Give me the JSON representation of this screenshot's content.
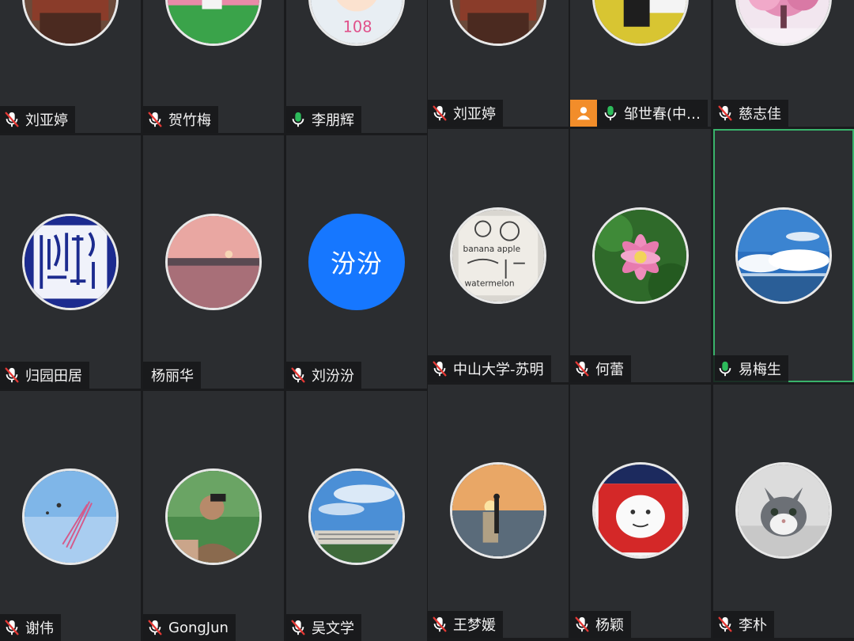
{
  "colors": {
    "tile_bg": "#2b2d30",
    "active_border": "#39b36b",
    "mic_on": "#2dbb5b",
    "mic_muted": "#e53935",
    "host_badge": "#f28d2a",
    "text_avatar": "#1677ff"
  },
  "participants": [
    {
      "name": "刘亚婷",
      "mic": "muted",
      "avatar": "photo-room"
    },
    {
      "name": "贺竹梅",
      "mic": "muted",
      "avatar": "photo-flowers"
    },
    {
      "name": "李朋辉",
      "mic": "on",
      "avatar": "cartoon-108"
    },
    {
      "name": "刘亚婷",
      "mic": "muted",
      "avatar": "photo-room"
    },
    {
      "name": "邹世春(中…",
      "mic": "on",
      "avatar": "photo-man-car",
      "host": true
    },
    {
      "name": "慈志佳",
      "mic": "muted",
      "avatar": "photo-pink-tree"
    },
    {
      "name": "归园田居",
      "mic": "muted",
      "avatar": "seal-stamp"
    },
    {
      "name": "杨丽华",
      "mic": "none",
      "avatar": "photo-sunset-river"
    },
    {
      "name": "刘汾汾",
      "mic": "muted",
      "avatar": "text",
      "avatar_text": "汾汾"
    },
    {
      "name": "中山大学-苏明",
      "mic": "muted",
      "avatar": "sketch-notes"
    },
    {
      "name": "何蕾",
      "mic": "muted",
      "avatar": "photo-lotus"
    },
    {
      "name": "易梅生",
      "mic": "on",
      "avatar": "photo-sky-clouds",
      "active": true
    },
    {
      "name": "谢伟",
      "mic": "muted",
      "avatar": "photo-kite"
    },
    {
      "name": "GongJun",
      "mic": "muted",
      "avatar": "photo-young-man"
    },
    {
      "name": "吴文学",
      "mic": "muted",
      "avatar": "photo-building"
    },
    {
      "name": "王梦媛",
      "mic": "muted",
      "avatar": "photo-sunrise-sea"
    },
    {
      "name": "杨颖",
      "mic": "muted",
      "avatar": "cartoon-red"
    },
    {
      "name": "李朴",
      "mic": "muted",
      "avatar": "photo-cat"
    }
  ]
}
